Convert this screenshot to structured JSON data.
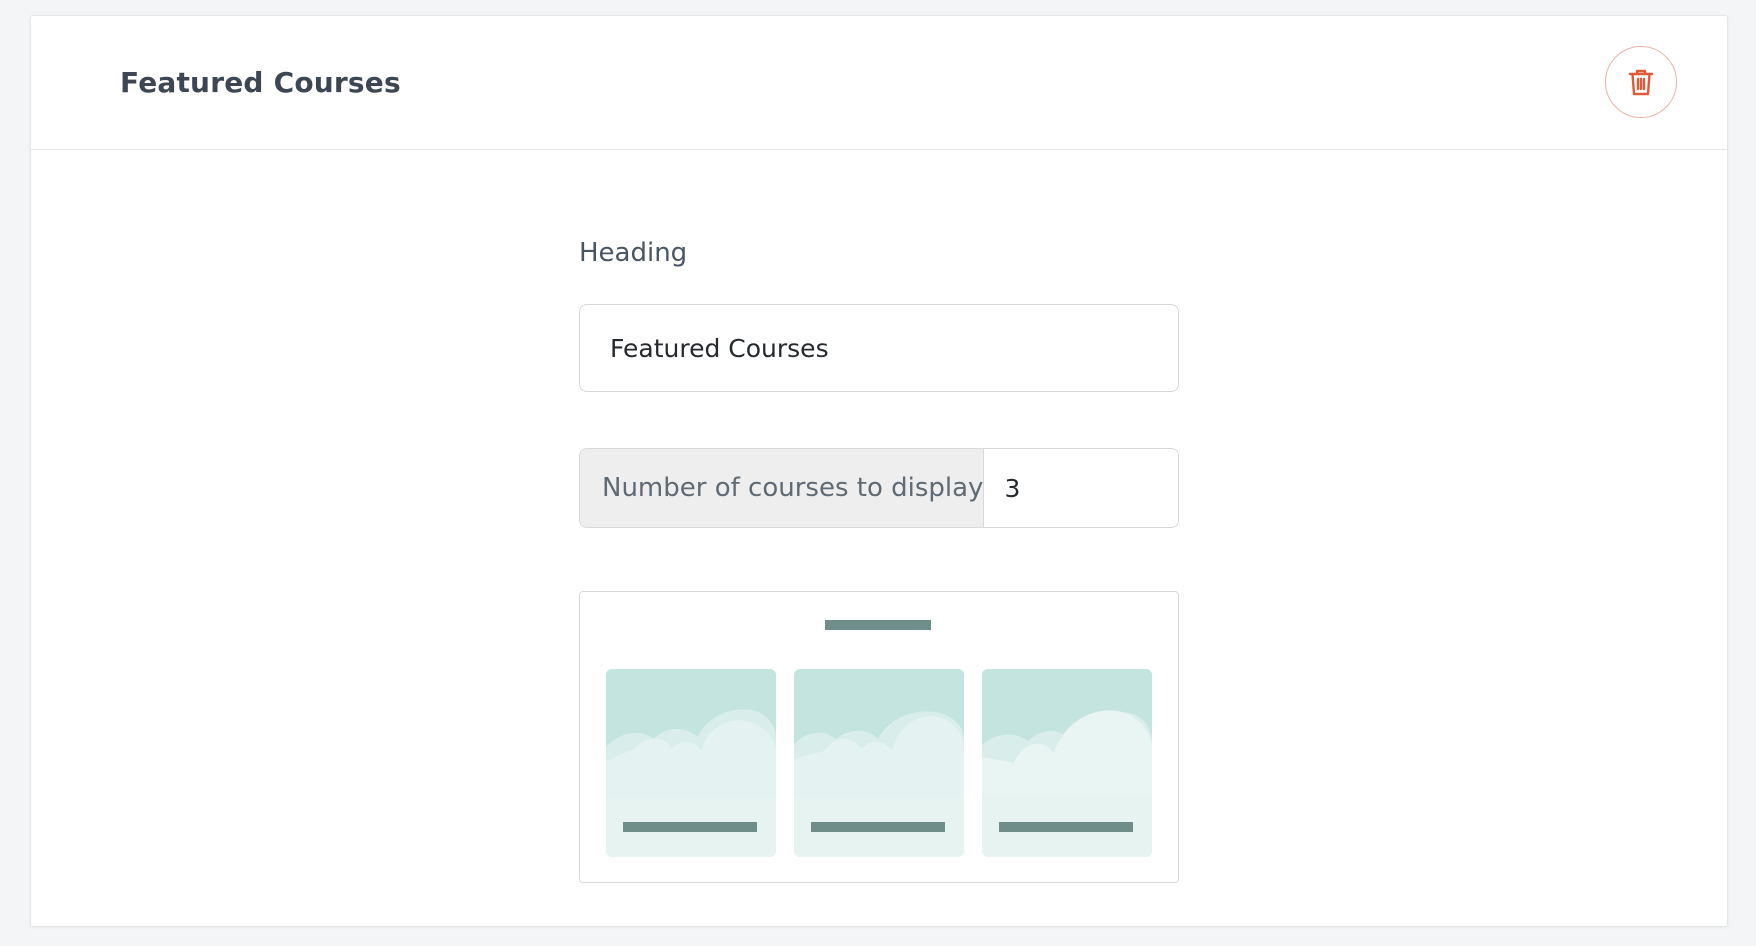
{
  "section": {
    "title": "Featured Courses"
  },
  "form": {
    "heading_label": "Heading",
    "heading_value": "Featured Courses",
    "count_label": "Number of courses to display",
    "count_value": "3"
  },
  "preview": {
    "course_count": 3
  },
  "icons": {
    "delete": "trash-icon",
    "spin_up": "caret-up-icon",
    "spin_down": "caret-down-icon"
  },
  "colors": {
    "danger": "#e05a3a",
    "preview_bar": "#6f8e8a",
    "preview_card": "#c4e4e0"
  }
}
